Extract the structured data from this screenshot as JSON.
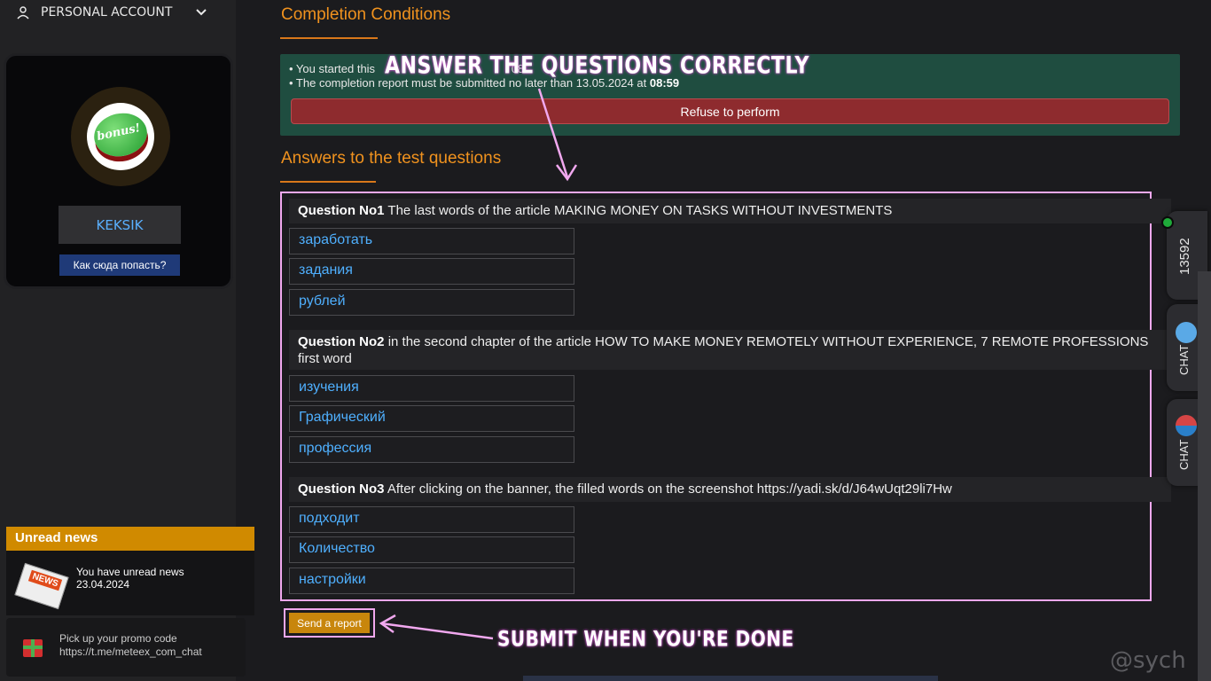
{
  "sidebar": {
    "account_label": "PERSONAL ACCOUNT",
    "username": "KEKSIK",
    "how_to_label": "Как сюда попасть?",
    "avatar_text": "bonus!",
    "news": {
      "header": "Unread news",
      "icon_text": "NEWS",
      "line1": "You have unread news",
      "line2": "23.04.2024"
    },
    "promo": {
      "line1": "Pick up your promo code",
      "line2": "https://t.me/meteex_com_chat"
    }
  },
  "main": {
    "completion_title": "Completion Conditions",
    "info": {
      "started_prefix": "• You started this",
      "started_visible": "08",
      "deadline_prefix": "• The completion report must be submitted no later than 13.05.2024 at",
      "deadline_time": "08:59",
      "refuse_label": "Refuse to perform"
    },
    "answers_title": "Answers to the test questions",
    "questions": [
      {
        "label": "Question No1",
        "text": "The last words of the article MAKING MONEY ON TASKS WITHOUT INVESTMENTS",
        "answers": [
          "заработать",
          "задания",
          "рублей"
        ]
      },
      {
        "label": "Question No2",
        "text": "in the second chapter of the article HOW TO MAKE MONEY REMOTELY WITHOUT EXPERIENCE, 7 REMOTE PROFESSIONS first word",
        "answers": [
          "изучения",
          "Графический",
          "профессия"
        ]
      },
      {
        "label": "Question No3",
        "text": "After clicking on the banner, the filled words on the screenshot https://yadi.sk/d/J64wUqt29li7Hw",
        "answers": [
          "подходит",
          "Количество",
          "настройки"
        ]
      }
    ],
    "send_label": "Send a report"
  },
  "annotations": {
    "top": "ANSWER THE QUESTIONS CORRECTLY",
    "bottom": "SUBMIT WHEN YOU'RE DONE"
  },
  "right_tabs": {
    "counter": "13592",
    "chat1": "CHAT",
    "chat2": "CHAT"
  },
  "watermark": "@sych",
  "colors": {
    "accent_orange": "#f0921e",
    "info_green": "#1f4d40",
    "refuse_red": "#8e2b2e",
    "answer_blue": "#4fb0ff",
    "annotation_pink": "#f1a8ef"
  }
}
